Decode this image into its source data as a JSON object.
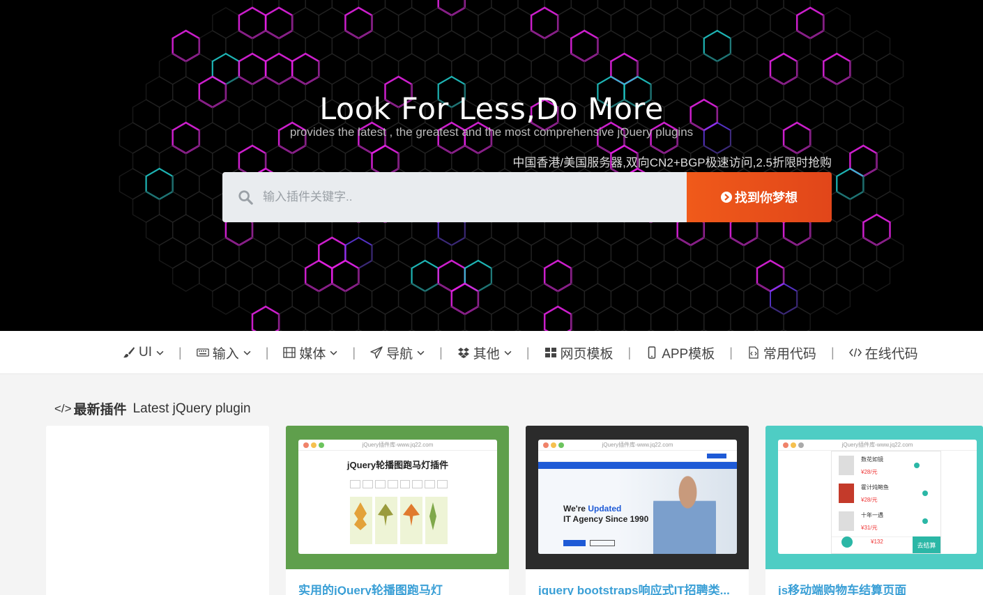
{
  "hero": {
    "title": "Look For Less,Do More",
    "subtitle": "provides the latest , the greatest and the most comprehensive jQuery plugins",
    "promo": "中国香港/美国服务器,双向CN2+BGP极速访问,2.5折限时抢购"
  },
  "search": {
    "placeholder": "输入插件关键字..",
    "button_label": "找到你梦想",
    "icon": "search-icon"
  },
  "nav": {
    "items": [
      {
        "label": "UI",
        "icon": "brush-icon",
        "dropdown": true
      },
      {
        "label": "输入",
        "icon": "keyboard-icon",
        "dropdown": true
      },
      {
        "label": "媒体",
        "icon": "film-icon",
        "dropdown": true
      },
      {
        "label": "导航",
        "icon": "paper-plane-icon",
        "dropdown": true
      },
      {
        "label": "其他",
        "icon": "dropbox-icon",
        "dropdown": true
      },
      {
        "label": "网页模板",
        "icon": "grid-icon",
        "dropdown": false
      },
      {
        "label": "APP模板",
        "icon": "mobile-icon",
        "dropdown": false
      },
      {
        "label": "常用代码",
        "icon": "code-file-icon",
        "dropdown": false
      },
      {
        "label": "在线代码",
        "icon": "code-icon",
        "dropdown": false
      }
    ],
    "separator": "|"
  },
  "section": {
    "title_bold": "最新插件",
    "title_rest": "Latest jQuery plugin",
    "icon_glyph": "</>"
  },
  "cards": [
    {
      "title": "",
      "thumb_color": "#ffffff"
    },
    {
      "title": "实用的jQuery轮播图跑马灯",
      "thumb_color": "#5f9f4c",
      "preview_url": "jQuery插件库-www.jq22.com",
      "preview_heading": "jQuery轮播图跑马灯插件"
    },
    {
      "title": "jquery bootstraps响应式IT招聘类...",
      "thumb_color": "#2b2b2b",
      "preview_url": "jQuery插件库-www.jq22.com",
      "preview_heading_a": "We're ",
      "preview_heading_b": "Updated",
      "preview_heading_c": "IT Agency Since 1990"
    },
    {
      "title": "js移动端购物车结算页面",
      "thumb_color": "#4ecdc4",
      "preview_url": "jQuery插件库-www.jq22.com",
      "preview_items": [
        "数花如镜",
        "霍计炖鲍鱼",
        "十年一遇"
      ],
      "preview_prices": [
        "¥28/元",
        "¥28/元",
        "¥31/元"
      ],
      "preview_total": "¥132",
      "preview_checkout": "去结算"
    }
  ],
  "colors": {
    "accent": "#e9531a",
    "link": "#3a9fd6",
    "hex_magenta": "#e020e0",
    "hex_cyan": "#20d0d0"
  }
}
